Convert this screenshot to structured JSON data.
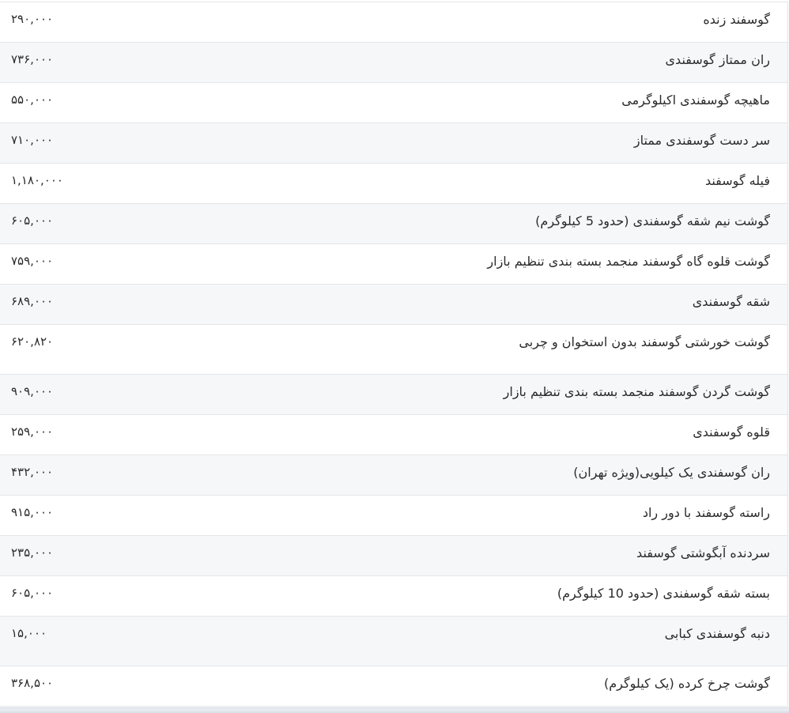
{
  "table": {
    "rows": [
      {
        "name": "گوسفند زنده",
        "price": "۲۹۰,۰۰۰"
      },
      {
        "name": "ران ممتاز گوسفندی",
        "price": "۷۳۶,۰۰۰"
      },
      {
        "name": "ماهیچه گوسفندی اکیلوگرمی",
        "price": "۵۵۰,۰۰۰"
      },
      {
        "name": "سر دست گوسفندی ممتاز",
        "price": "۷۱۰,۰۰۰"
      },
      {
        "name": "فیله گوسفند",
        "price": "۱,۱۸۰,۰۰۰"
      },
      {
        "name": "گوشت نیم شقه گوسفندی (حدود 5 کیلوگرم)",
        "price": "۶۰۵,۰۰۰"
      },
      {
        "name": "گوشت قلوه گاه گوسفند منجمد بسته بندی تنظیم بازار",
        "price": "۷۵۹,۰۰۰"
      },
      {
        "name": "شقه گوسفندی",
        "price": "۶۸۹,۰۰۰"
      },
      {
        "name": "گوشت خورشتی گوسفند بدون استخوان و چربی",
        "price": "۶۲۰,۸۲۰"
      },
      {
        "name": "گوشت گردن گوسفند منجمد بسته بندی تنظیم بازار",
        "price": "۹۰۹,۰۰۰"
      },
      {
        "name": "قلوه گوسفندی",
        "price": "۲۵۹,۰۰۰"
      },
      {
        "name": "ران گوسفندی یک کیلویی(ویژه تهران)",
        "price": "۴۳۲,۰۰۰"
      },
      {
        "name": "راسته گوسفند با دور راد",
        "price": "۹۱۵,۰۰۰"
      },
      {
        "name": "سردنده آبگوشتی گوسفند",
        "price": "۲۳۵,۰۰۰"
      },
      {
        "name": "بسته شقه گوسفندی (حدود 10 کیلوگرم)",
        "price": "۶۰۵,۰۰۰"
      },
      {
        "name": "دنبه گوسفندی کبابی",
        "price": "۱۵,۰۰۰"
      },
      {
        "name": "گوشت چرخ کرده (یک کیلوگرم)",
        "price": "۳۶۸,۵۰۰"
      }
    ]
  }
}
